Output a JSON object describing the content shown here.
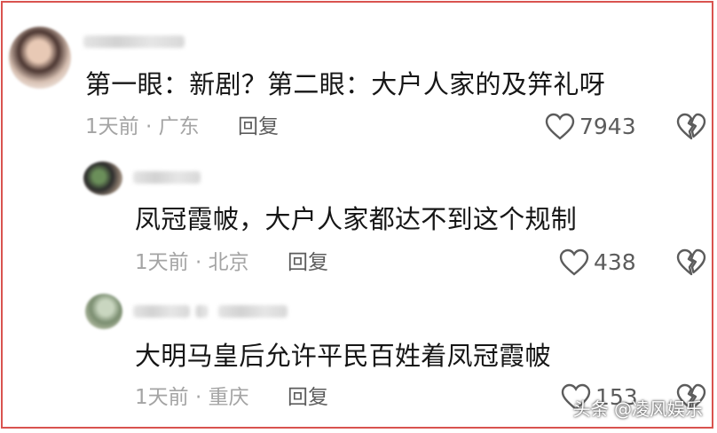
{
  "comments": [
    {
      "text": "第一眼：新剧？第二眼：大户人家的及笄礼呀",
      "time_location": "1天前 · 广东",
      "reply_label": "回复",
      "likes": "7943"
    },
    {
      "text": "凤冠霞帔，大户人家都达不到这个规制",
      "time_location": "1天前 · 北京",
      "reply_label": "回复",
      "likes": "438"
    },
    {
      "text": "大明马皇后允许平民百姓着凤冠霞帔",
      "time_location": "1天前 · 重庆",
      "reply_label": "回复",
      "likes": "153"
    }
  ],
  "watermark": "头条 @凌风娱乐",
  "colors": {
    "border": "#d9534f",
    "text": "#161616",
    "meta": "#a4a4a4",
    "action": "#5c5c5c"
  },
  "icons": {
    "like": "heart-outline-icon",
    "dislike": "broken-heart-icon"
  }
}
